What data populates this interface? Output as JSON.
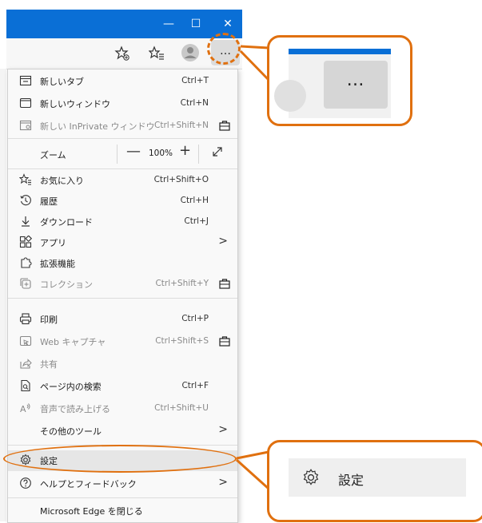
{
  "window": {
    "minimize": "—",
    "maximize": "☐",
    "close": "✕"
  },
  "toolbar": {
    "more_label": "…"
  },
  "menu": {
    "new_tab": {
      "label": "新しいタブ",
      "shortcut": "Ctrl+T"
    },
    "new_window": {
      "label": "新しいウィンドウ",
      "shortcut": "Ctrl+N"
    },
    "new_inprivate": {
      "label": "新しい InPrivate ウィンドウ",
      "shortcut": "Ctrl+Shift+N"
    },
    "zoom": {
      "label": "ズーム",
      "minus": "—",
      "value": "100%",
      "plus": "+"
    },
    "favorites": {
      "label": "お気に入り",
      "shortcut": "Ctrl+Shift+O"
    },
    "history": {
      "label": "履歴",
      "shortcut": "Ctrl+H"
    },
    "downloads": {
      "label": "ダウンロード",
      "shortcut": "Ctrl+J"
    },
    "apps": {
      "label": "アプリ",
      "arrow": ">"
    },
    "extensions": {
      "label": "拡張機能"
    },
    "collections": {
      "label": "コレクション",
      "shortcut": "Ctrl+Shift+Y"
    },
    "print": {
      "label": "印刷",
      "shortcut": "Ctrl+P"
    },
    "web_capture": {
      "label": "Web キャプチャ",
      "shortcut": "Ctrl+Shift+S"
    },
    "share": {
      "label": "共有"
    },
    "find": {
      "label": "ページ内の検索",
      "shortcut": "Ctrl+F"
    },
    "read_aloud": {
      "label": "音声で読み上げる",
      "shortcut": "Ctrl+Shift+U"
    },
    "more_tools": {
      "label": "その他のツール",
      "arrow": ">"
    },
    "settings": {
      "label": "設定"
    },
    "help": {
      "label": "ヘルプとフィードバック",
      "arrow": ">"
    },
    "close_edge": {
      "label": "Microsoft Edge を閉じる"
    }
  },
  "callouts": {
    "more_button_zoom": {
      "label": "…"
    },
    "settings_zoom": {
      "label": "設定"
    }
  },
  "colors": {
    "accent_orange": "#e0700f",
    "titlebar_blue": "#0a6fd6"
  }
}
